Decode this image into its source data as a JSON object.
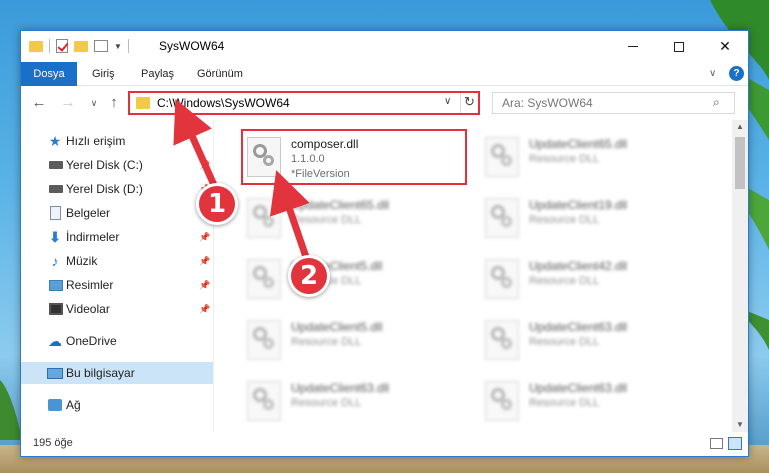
{
  "window": {
    "title": "SysWOW64",
    "minimize_icon": "minimize-icon",
    "maximize_icon": "maximize-icon",
    "close_icon": "close-icon"
  },
  "ribbon": {
    "tabs": [
      {
        "label": "Dosya",
        "active": true
      },
      {
        "label": "Giriş"
      },
      {
        "label": "Paylaş"
      },
      {
        "label": "Görünüm"
      }
    ],
    "help": "?"
  },
  "nav": {
    "address": "C:\\Windows\\SysWOW64",
    "search_placeholder": "Ara: SysWOW64"
  },
  "sidebar": {
    "items": [
      {
        "label": "Hızlı erişim",
        "icon": "star-icon"
      },
      {
        "label": "Yerel Disk (C:)",
        "icon": "drive-icon",
        "pinned": true
      },
      {
        "label": "Yerel Disk (D:)",
        "icon": "drive-icon",
        "pinned": true
      },
      {
        "label": "Belgeler",
        "icon": "documents-icon",
        "pinned": true
      },
      {
        "label": "İndirmeler",
        "icon": "downloads-icon",
        "pinned": true
      },
      {
        "label": "Müzik",
        "icon": "music-icon",
        "pinned": true
      },
      {
        "label": "Resimler",
        "icon": "pictures-icon",
        "pinned": true
      },
      {
        "label": "Videolar",
        "icon": "videos-icon",
        "pinned": true
      },
      {
        "label": "OneDrive",
        "icon": "onedrive-icon"
      },
      {
        "label": "Bu bilgisayar",
        "icon": "this-pc-icon",
        "selected": true
      },
      {
        "label": "Ağ",
        "icon": "network-icon"
      }
    ]
  },
  "files": [
    {
      "name": "composer.dll",
      "line2": "1.1.0.0",
      "line3": "*FileVersion"
    },
    {
      "name": "UpdateClient65.dll",
      "line2": "Resource DLL"
    },
    {
      "name": "UpdateClient65.dll",
      "line2": "Resource DLL"
    },
    {
      "name": "UpdateClient19.dll",
      "line2": "Resource DLL"
    },
    {
      "name": "UpdateClient5.dll",
      "line2": "Resource DLL"
    },
    {
      "name": "UpdateClient42.dll",
      "line2": "Resource DLL"
    },
    {
      "name": "UpdateClient5.dll",
      "line2": "Resource DLL"
    },
    {
      "name": "UpdateClient63.dll",
      "line2": "Resource DLL"
    },
    {
      "name": "UpdateClient63.dll",
      "line2": "Resource DLL"
    },
    {
      "name": "UpdateClient63.dll",
      "line2": "Resource DLL"
    }
  ],
  "status": {
    "item_count": "195 öğe"
  },
  "annotations": {
    "marker_1": "1",
    "marker_2": "2",
    "color": "#e2343c"
  }
}
